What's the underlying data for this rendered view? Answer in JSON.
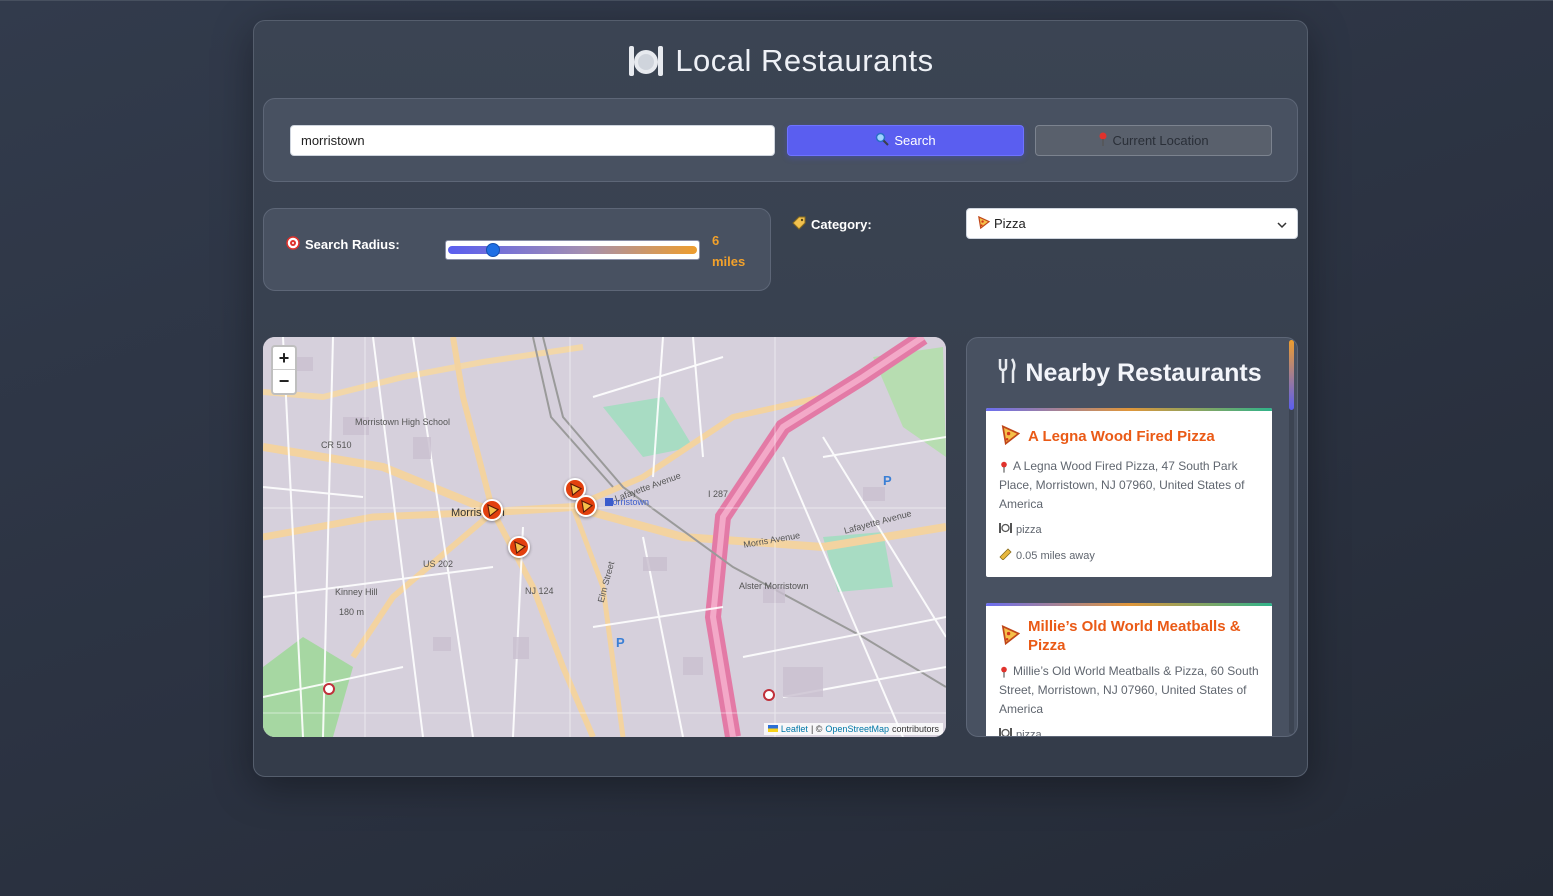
{
  "header": {
    "title": "Local Restaurants",
    "icon": "plate-cutlery-icon"
  },
  "search": {
    "value": "morristown",
    "search_label": "Search",
    "location_label": "Current Location"
  },
  "radius": {
    "label": "Search Radius:",
    "value": 6,
    "value_text": "6",
    "unit": "miles",
    "slider_fraction": 0.16
  },
  "category": {
    "label": "Category:",
    "selected": "Pizza"
  },
  "map": {
    "zoom_in": "+",
    "zoom_out": "−",
    "attribution": {
      "leaflet": "Leaflet",
      "sep": "| ©",
      "osm": "OpenStreetMap",
      "suffix": "contributors"
    },
    "labels": {
      "town": "Morristown",
      "cr510": "CR 510",
      "us202": "US 202",
      "nj124": "NJ 124",
      "i287": "I 287",
      "lafayette": "Lafayette Avenue",
      "morris": "Morris Avenue",
      "elm": "Elm Street",
      "kinney": "Kinney Hill",
      "kinney_elev": "180 m",
      "morristown_hs": "Morristown High School",
      "alstermorristown": "Alster Morristown",
      "parking": "P"
    }
  },
  "nearby": {
    "title": "Nearby Restaurants",
    "restaurants": [
      {
        "name": "A Legna Wood Fired Pizza",
        "address": "A Legna Wood Fired Pizza, 47 South Park Place, Morristown, NJ 07960, United States of America",
        "cuisine": "pizza",
        "distance": "0.05 miles away"
      },
      {
        "name": "Millie’s Old World Meatballs & Pizza",
        "address": "Millie’s Old World Meatballs & Pizza, 60 South Street, Morristown, NJ 07960, United States of America",
        "cuisine": "pizza",
        "distance": ""
      }
    ]
  },
  "colors": {
    "accent": "#5a5ef0",
    "orange": "#f2a12b",
    "marker": "#e2400e",
    "name": "#ea5a16"
  }
}
